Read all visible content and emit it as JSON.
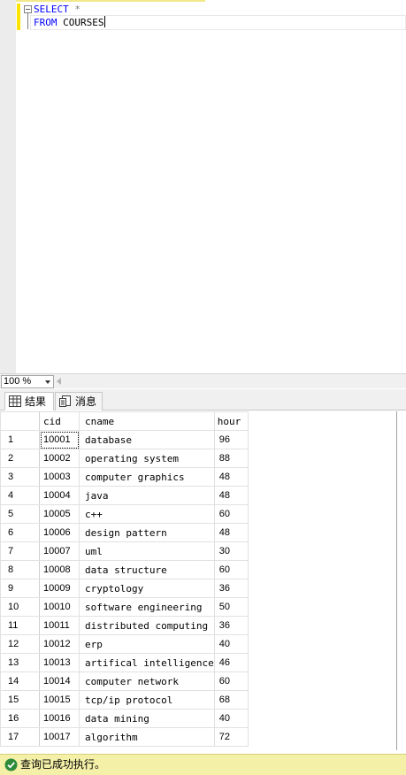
{
  "editor": {
    "lines": [
      {
        "keyword": "SELECT",
        "rest": " *"
      },
      {
        "keyword": "FROM",
        "rest": " COURSES"
      }
    ]
  },
  "zoom": {
    "value": "100 %"
  },
  "tabs": {
    "results_label": "结果",
    "messages_label": "消息"
  },
  "grid": {
    "columns": [
      "cid",
      "cname",
      "hour"
    ],
    "rows": [
      {
        "num": "1",
        "cid": "10001",
        "cname": "database",
        "hour": "96"
      },
      {
        "num": "2",
        "cid": "10002",
        "cname": "operating system",
        "hour": "88"
      },
      {
        "num": "3",
        "cid": "10003",
        "cname": "computer graphics",
        "hour": "48"
      },
      {
        "num": "4",
        "cid": "10004",
        "cname": "java",
        "hour": "48"
      },
      {
        "num": "5",
        "cid": "10005",
        "cname": "c++",
        "hour": "60"
      },
      {
        "num": "6",
        "cid": "10006",
        "cname": "design pattern",
        "hour": "48"
      },
      {
        "num": "7",
        "cid": "10007",
        "cname": "uml",
        "hour": "30"
      },
      {
        "num": "8",
        "cid": "10008",
        "cname": "data structure",
        "hour": "60"
      },
      {
        "num": "9",
        "cid": "10009",
        "cname": "cryptology",
        "hour": "36"
      },
      {
        "num": "10",
        "cid": "10010",
        "cname": "software engineering",
        "hour": "50"
      },
      {
        "num": "11",
        "cid": "10011",
        "cname": "distributed computing",
        "hour": "36"
      },
      {
        "num": "12",
        "cid": "10012",
        "cname": "erp",
        "hour": "40"
      },
      {
        "num": "13",
        "cid": "10013",
        "cname": "artifical intelligence",
        "hour": "46"
      },
      {
        "num": "14",
        "cid": "10014",
        "cname": "computer network",
        "hour": "60"
      },
      {
        "num": "15",
        "cid": "10015",
        "cname": "tcp/ip protocol",
        "hour": "68"
      },
      {
        "num": "16",
        "cid": "10016",
        "cname": "data mining",
        "hour": "40"
      },
      {
        "num": "17",
        "cid": "10017",
        "cname": "algorithm",
        "hour": "72"
      }
    ]
  },
  "status": {
    "text": "查询已成功执行。",
    "icon": "check-circle-icon",
    "color": "#f4f0a8"
  }
}
